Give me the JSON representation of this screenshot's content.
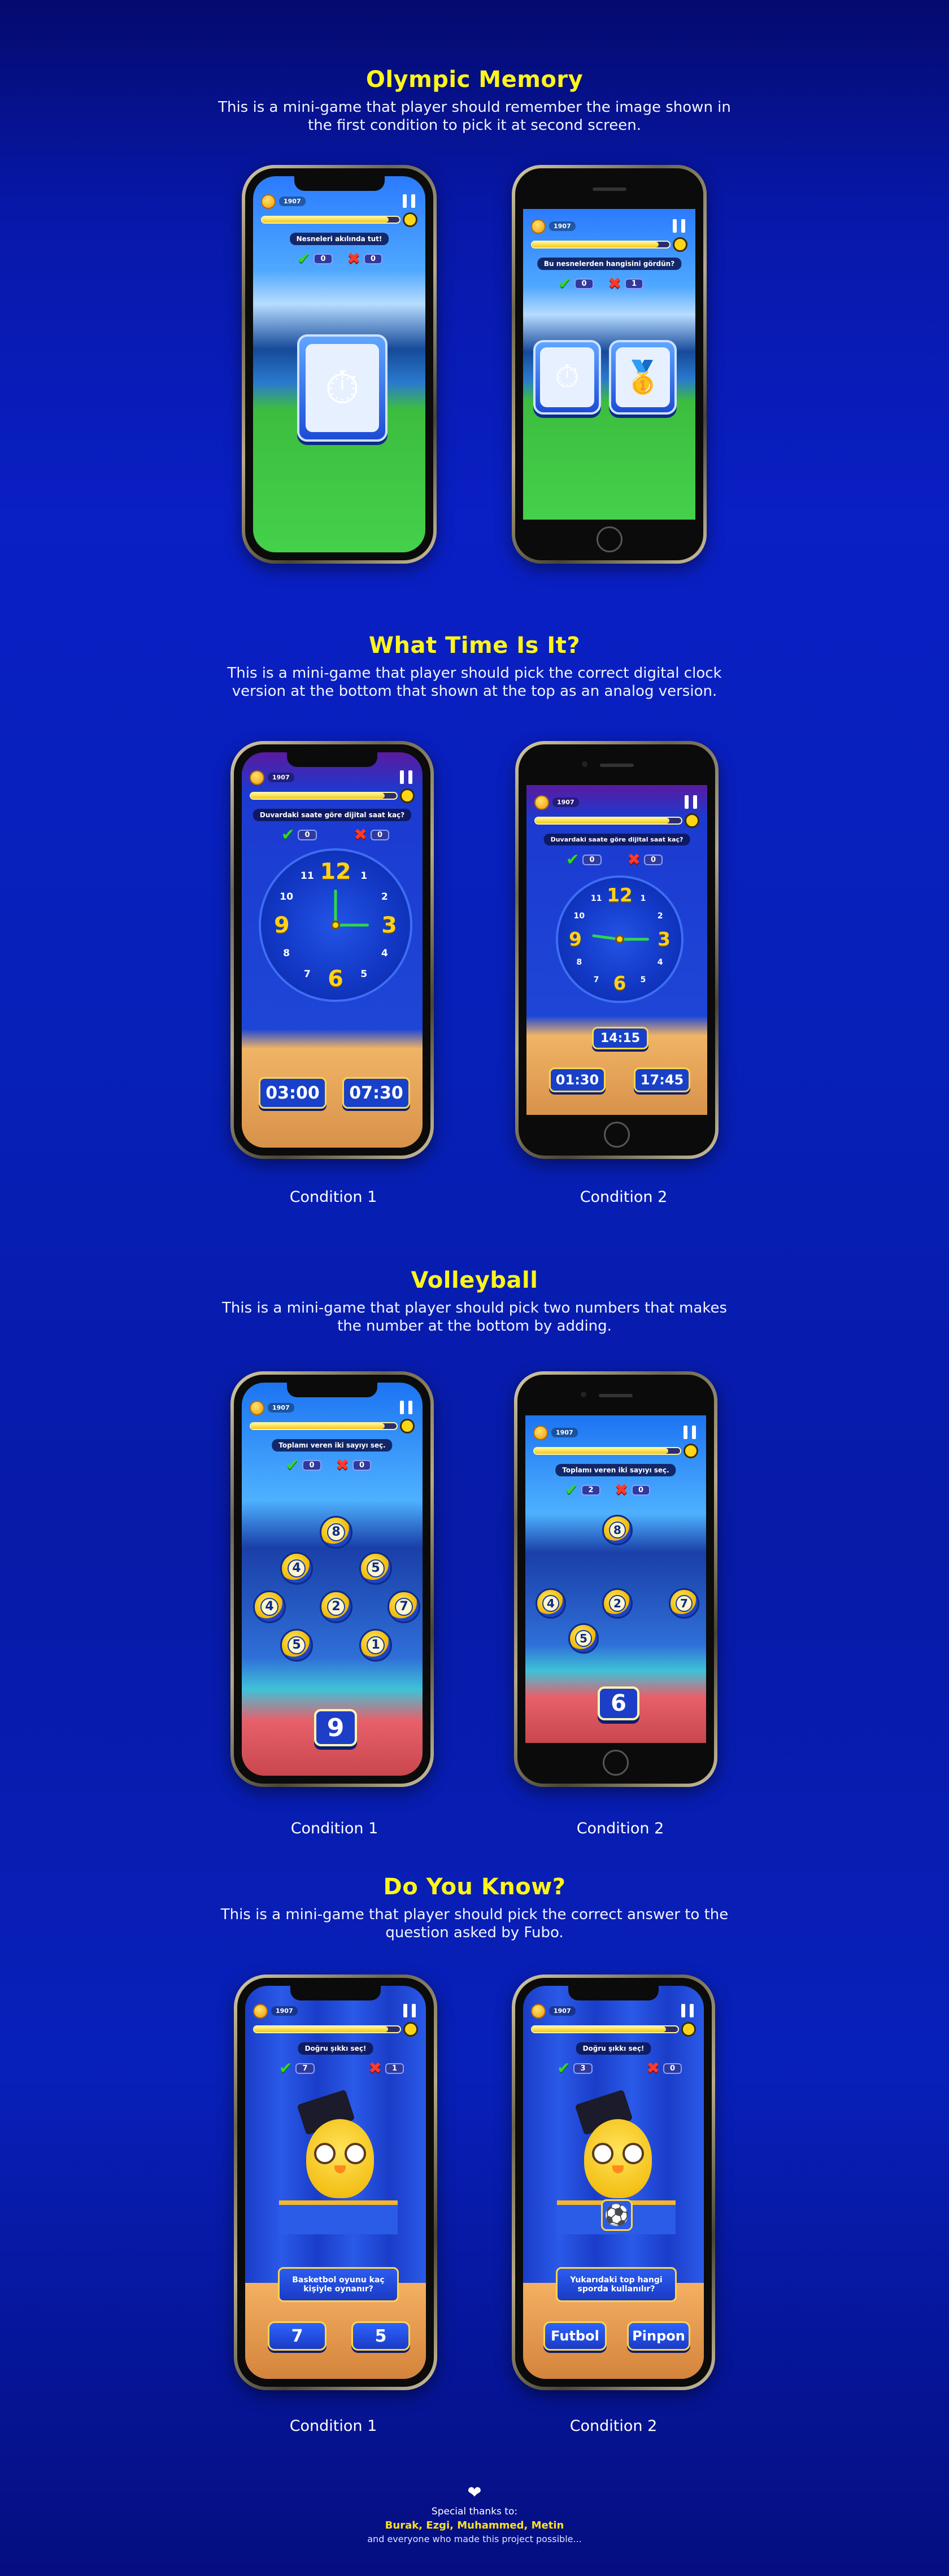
{
  "sections": [
    {
      "title": "Olympic Memory",
      "description": "This is a mini-game that player should remember the image shown in the first condition to pick it at second screen."
    },
    {
      "title": "What Time Is It?",
      "description": "This is a mini-game that player should pick the correct digital clock version at the bottom that shown at the top as an analog version.",
      "captions": [
        "Condition 1",
        "Condition 2"
      ]
    },
    {
      "title": "Volleyball",
      "description": "This is a mini-game that player should pick two numbers that makes the number at the bottom by adding.",
      "captions": [
        "Condition 1",
        "Condition 2"
      ]
    },
    {
      "title": "Do You Know?",
      "description": "This is a mini-game that player should pick the correct answer to the question asked by Fubo.",
      "captions": [
        "Condition 1",
        "Condition 2"
      ]
    }
  ],
  "hud": {
    "coins": "1907"
  },
  "olympic": {
    "c1": {
      "prompt": "Nesneleri akılında tut!",
      "correct": "0",
      "wrong": "0"
    },
    "c2": {
      "prompt": "Bu nesnelerden hangisini gördün?",
      "correct": "0",
      "wrong": "1"
    },
    "icons": [
      "stopwatch-icon",
      "medal-icon"
    ]
  },
  "clock": {
    "prompt": "Duvardaki saate göre dijital saat kaç?",
    "c1": {
      "correct": "0",
      "wrong": "0",
      "options": [
        "03:00",
        "07:30"
      ]
    },
    "c2": {
      "correct": "0",
      "wrong": "0",
      "shown": "14:15",
      "options": [
        "01:30",
        "17:45"
      ]
    },
    "numbers": [
      "12",
      "1",
      "2",
      "3",
      "4",
      "5",
      "6",
      "7",
      "8",
      "9",
      "10",
      "11"
    ]
  },
  "volley": {
    "prompt": "Toplamı veren iki sayıyı seç.",
    "c1": {
      "correct": "0",
      "wrong": "0",
      "balls": [
        "8",
        "4",
        "5",
        "4",
        "2",
        "7",
        "5",
        "1"
      ],
      "target": "9"
    },
    "c2": {
      "correct": "2",
      "wrong": "0",
      "balls": [
        "8",
        "4",
        "2",
        "7",
        "5"
      ],
      "target": "6"
    }
  },
  "quiz": {
    "prompt": "Doğru şıkkı seç!",
    "c1": {
      "correct": "7",
      "wrong": "1",
      "question": "Basketbol oyunu kaç kişiyle oynanır?",
      "options": [
        "7",
        "5"
      ]
    },
    "c2": {
      "correct": "3",
      "wrong": "0",
      "question": "Yukarıdaki top hangi sporda kullanılır?",
      "options": [
        "Futbol",
        "Pinpon"
      ]
    }
  },
  "thanks": {
    "line1": "Special thanks to:",
    "names": "Burak, Ezgi, Muhammed, Metin",
    "line3": "and everyone who made this project possible..."
  }
}
